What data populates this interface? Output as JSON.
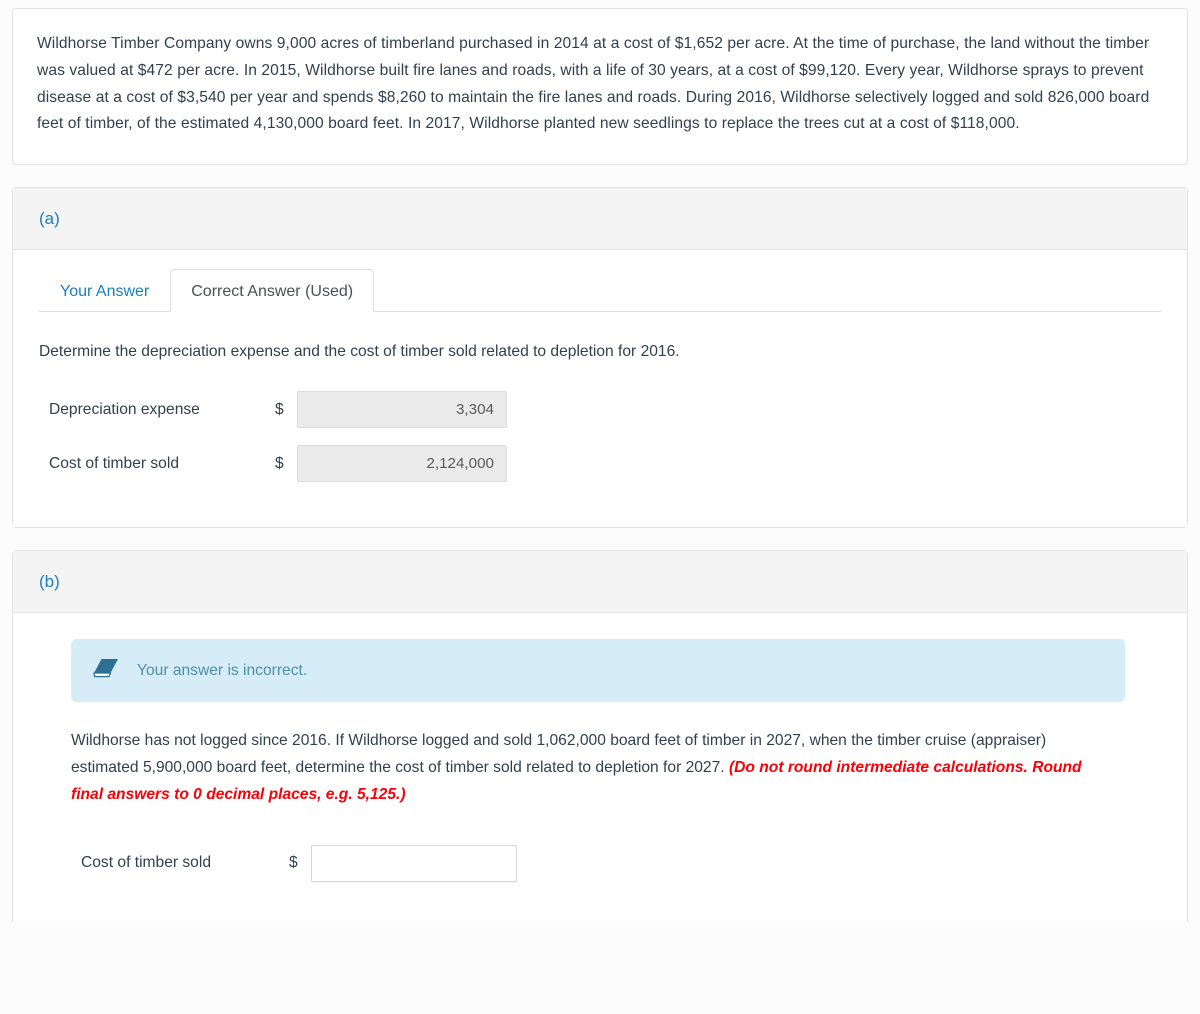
{
  "problem": {
    "text": "Wildhorse Timber Company owns 9,000 acres of timberland purchased in 2014 at a cost of $1,652 per acre. At the time of purchase, the land without the timber was valued at $472 per acre. In 2015, Wildhorse built fire lanes and roads, with a life of 30 years, at a cost of $99,120. Every year, Wildhorse sprays to prevent disease at a cost of $3,540 per year and spends $8,260 to maintain the fire lanes and roads. During 2016, Wildhorse selectively logged and sold 826,000 board feet of timber, of the estimated 4,130,000 board feet. In 2017, Wildhorse planted new seedlings to replace the trees cut at a cost of $118,000."
  },
  "colors": {
    "accent_blue": "#1a7fbf",
    "alert_bg": "#d6ecf6",
    "alert_text": "#4d8fa8",
    "note_red": "#fb0007",
    "body_text": "#32404e",
    "readonly_bg": "#ebebeb",
    "card_border": "#e3e3e3",
    "header_bg": "#f4f4f4"
  },
  "part_a": {
    "label": "(a)",
    "tabs": [
      {
        "label": "Your Answer",
        "active": false
      },
      {
        "label": "Correct Answer (Used)",
        "active": true
      }
    ],
    "prompt": "Determine the depreciation expense and the cost of timber sold related to depletion for 2016.",
    "rows": [
      {
        "label": "Depreciation expense",
        "currency": "$",
        "value": "3,304",
        "readonly": true
      },
      {
        "label": "Cost of timber sold",
        "currency": "$",
        "value": "2,124,000",
        "readonly": true
      }
    ]
  },
  "part_b": {
    "label": "(b)",
    "alert": {
      "icon": "eraser-icon",
      "text": "Your answer is incorrect."
    },
    "question": {
      "main": "Wildhorse has not logged since 2016. If Wildhorse logged and sold 1,062,000 board feet of timber in 2027, when the timber cruise (appraiser) estimated 5,900,000 board feet, determine the cost of timber sold related to depletion for 2027. ",
      "note": "(Do not round intermediate calculations. Round final answers to 0 decimal places, e.g. 5,125.)"
    },
    "rows": [
      {
        "label": "Cost of timber sold",
        "currency": "$",
        "value": "",
        "placeholder": "",
        "readonly": false
      }
    ]
  }
}
